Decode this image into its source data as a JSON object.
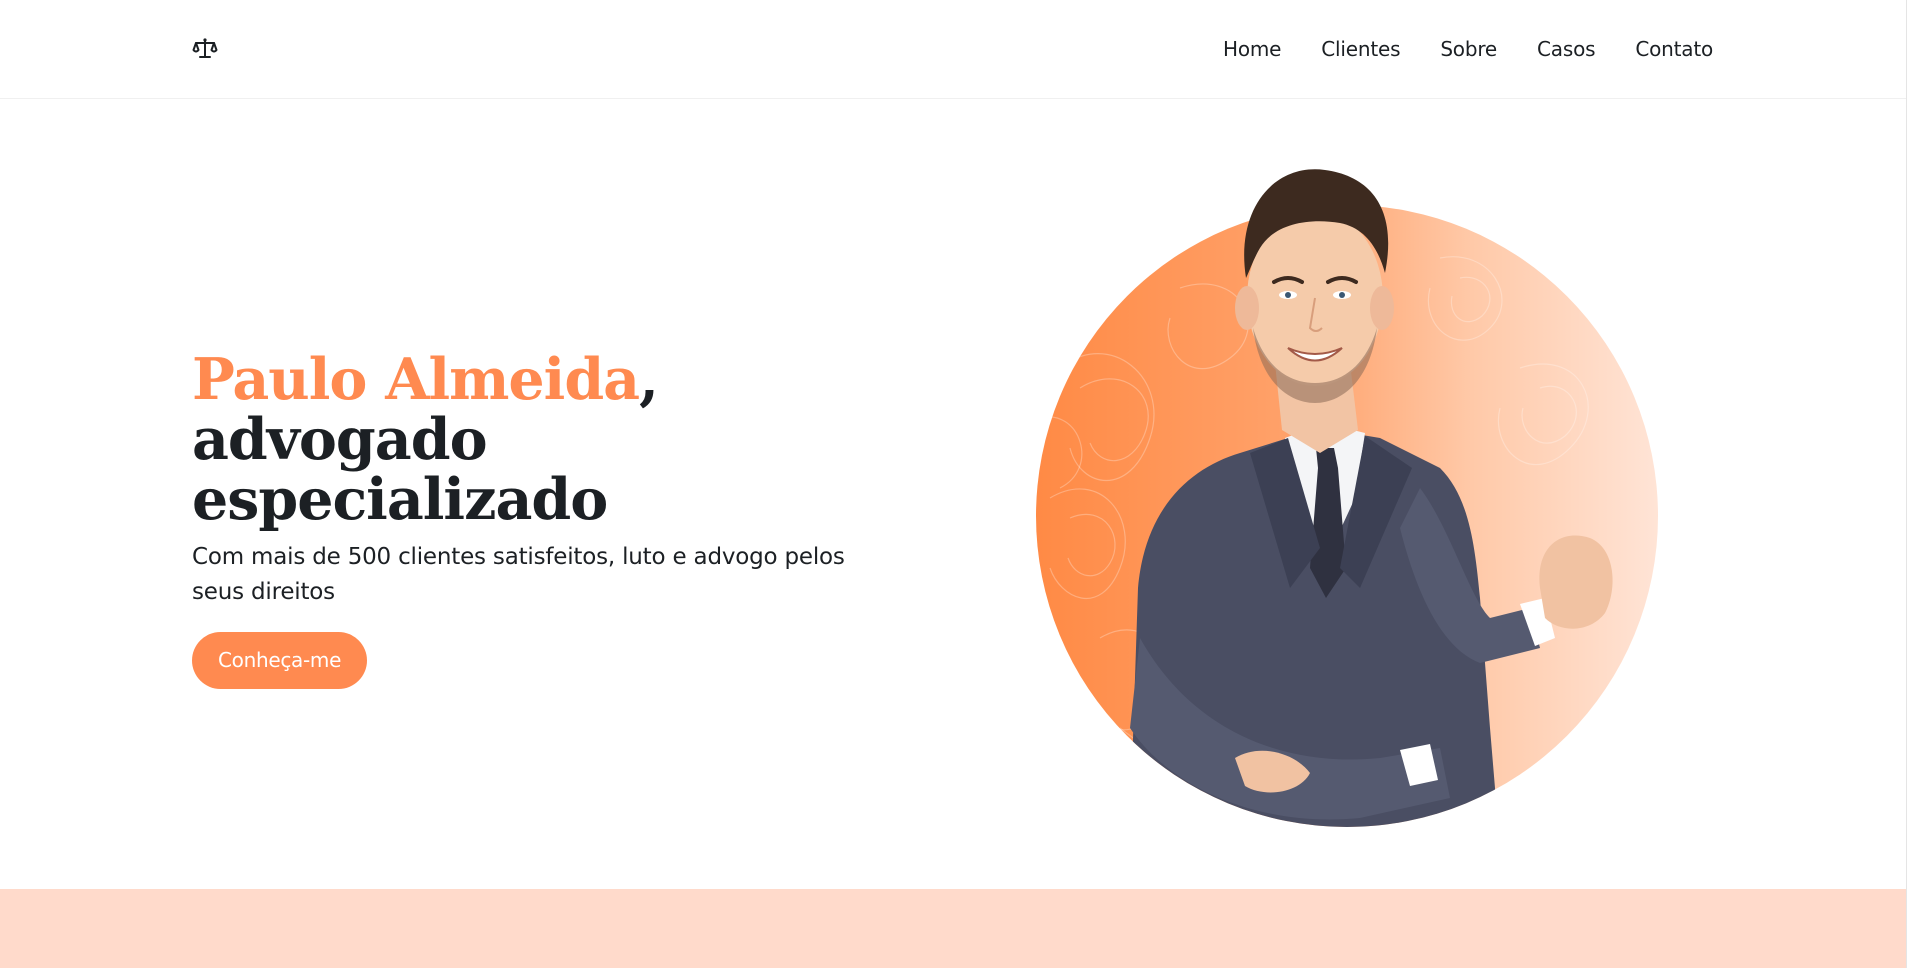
{
  "header": {
    "logo_icon": "scales-of-justice-icon",
    "nav": [
      "Home",
      "Clientes",
      "Sobre",
      "Casos",
      "Contato"
    ]
  },
  "hero": {
    "name": "Paulo Almeida",
    "comma": ",",
    "title_line": "advogado especializado",
    "subtitle": "Com mais de 500 clientes satisfeitos, luto e advogo pelos seus direitos",
    "cta_label": "Conheça-me"
  },
  "colors": {
    "accent": "#ff8a50",
    "text": "#1c2024",
    "band": "#ffdacb",
    "background": "#ffffff"
  }
}
